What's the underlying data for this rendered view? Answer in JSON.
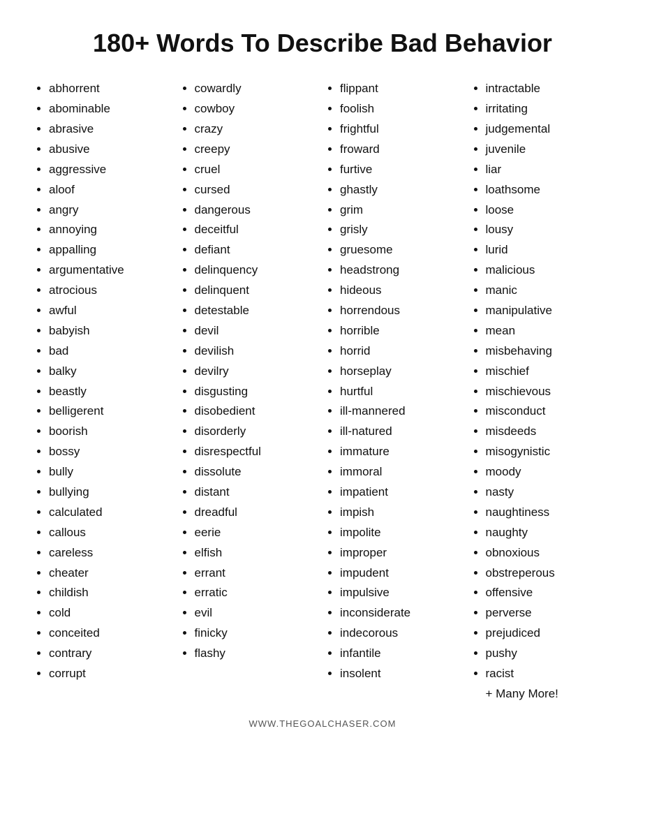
{
  "title": "180+ Words To Describe Bad Behavior",
  "columns": [
    {
      "id": "col1",
      "words": [
        "abhorrent",
        "abominable",
        "abrasive",
        "abusive",
        "aggressive",
        "aloof",
        "angry",
        "annoying",
        "appalling",
        "argumentative",
        "atrocious",
        "awful",
        "babyish",
        "bad",
        "balky",
        "beastly",
        "belligerent",
        "boorish",
        "bossy",
        "bully",
        "bullying",
        "calculated",
        "callous",
        "careless",
        "cheater",
        "childish",
        "cold",
        "conceited",
        "contrary",
        "corrupt"
      ]
    },
    {
      "id": "col2",
      "words": [
        "cowardly",
        "cowboy",
        "crazy",
        "creepy",
        "cruel",
        "cursed",
        "dangerous",
        "deceitful",
        "defiant",
        "delinquency",
        "delinquent",
        "detestable",
        "devil",
        "devilish",
        "devilry",
        "disgusting",
        "disobedient",
        "disorderly",
        "disrespectful",
        "dissolute",
        "distant",
        "dreadful",
        "eerie",
        "elfish",
        "errant",
        "erratic",
        "evil",
        "finicky",
        "flashy"
      ]
    },
    {
      "id": "col3",
      "words": [
        "flippant",
        "foolish",
        "frightful",
        "froward",
        "furtive",
        "ghastly",
        "grim",
        "grisly",
        "gruesome",
        "headstrong",
        "hideous",
        "horrendous",
        "horrible",
        "horrid",
        "horseplay",
        "hurtful",
        "ill-mannered",
        "ill-natured",
        "immature",
        "immoral",
        "impatient",
        "impish",
        "impolite",
        "improper",
        "impudent",
        "impulsive",
        "inconsiderate",
        "indecorous",
        "infantile",
        "insolent"
      ]
    },
    {
      "id": "col4",
      "words": [
        "intractable",
        "irritating",
        "judgemental",
        "juvenile",
        "liar",
        "loathsome",
        "loose",
        "lousy",
        "lurid",
        "malicious",
        "manic",
        "manipulative",
        "mean",
        "misbehaving",
        "mischief",
        "mischievous",
        "misconduct",
        "misdeeds",
        "misogynistic",
        "moody",
        "nasty",
        "naughtiness",
        "naughty",
        "obnoxious",
        "obstreperous",
        "offensive",
        "perverse",
        "prejudiced",
        "pushy",
        "racist"
      ]
    }
  ],
  "more_label": "+ Many More!",
  "footer_text": "WWW.THEGOALCHASER.COM"
}
